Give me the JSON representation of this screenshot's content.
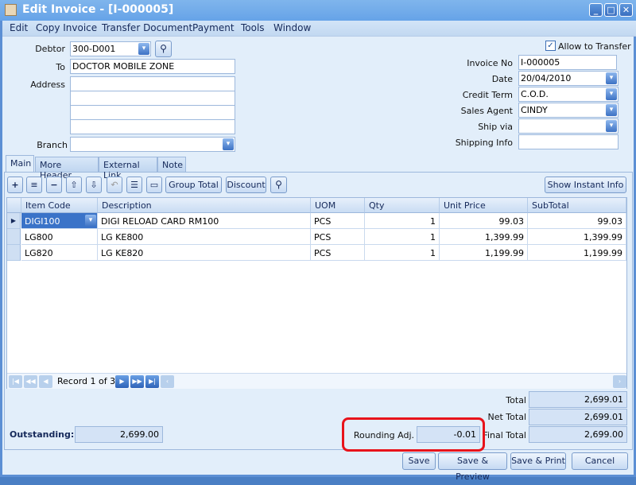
{
  "window": {
    "title": "Edit Invoice - [I-000005]",
    "minimize": "_",
    "maximize": "□",
    "close": "✕"
  },
  "menu": [
    "Edit",
    "Copy Invoice",
    "Transfer Document",
    "Payment",
    "Tools",
    "Window"
  ],
  "header": {
    "debtor_label": "Debtor",
    "debtor": "300-D001",
    "to_label": "To",
    "to": "DOCTOR MOBILE ZONE",
    "address_label": "Address",
    "address": [
      "",
      "",
      "",
      ""
    ],
    "branch_label": "Branch",
    "branch": "",
    "allow_transfer_label": "Allow to Transfer",
    "allow_transfer": true,
    "invoice_no_label": "Invoice No",
    "invoice_no": "I-000005",
    "date_label": "Date",
    "date": "20/04/2010",
    "credit_term_label": "Credit Term",
    "credit_term": "C.O.D.",
    "sales_agent_label": "Sales Agent",
    "sales_agent": "CINDY",
    "ship_via_label": "Ship via",
    "ship_via": "",
    "shipping_info_label": "Shipping Info",
    "shipping_info": ""
  },
  "tabs": [
    "Main",
    "More Header",
    "External Link",
    "Note"
  ],
  "toolbar": {
    "group_total": "Group Total",
    "discount": "Discount",
    "show_instant_info": "Show Instant Info"
  },
  "grid": {
    "columns": [
      "Item Code",
      "Description",
      "UOM",
      "Qty",
      "Unit Price",
      "SubTotal"
    ],
    "rows": [
      [
        "DIGI100",
        "DIGI RELOAD CARD RM100",
        "PCS",
        "1",
        "99.03",
        "99.03"
      ],
      [
        "LG800",
        "LG KE800",
        "PCS",
        "1",
        "1,399.99",
        "1,399.99"
      ],
      [
        "LG820",
        "LG KE820",
        "PCS",
        "1",
        "1,199.99",
        "1,199.99"
      ]
    ],
    "record_label": "Record 1 of 3"
  },
  "totals": {
    "outstanding_label": "Outstanding:",
    "outstanding": "2,699.00",
    "total_label": "Total",
    "total": "2,699.01",
    "net_total_label": "Net Total",
    "net_total": "2,699.01",
    "rounding_label": "Rounding Adj.",
    "rounding": "-0.01",
    "final_total_label": "Final Total",
    "final_total": "2,699.00"
  },
  "buttons": {
    "save": "Save",
    "save_preview": "Save & Preview",
    "save_print": "Save & Print",
    "cancel": "Cancel"
  },
  "colors": {
    "highlight": "#e8131b",
    "title_bar": "#6fa9ea"
  }
}
